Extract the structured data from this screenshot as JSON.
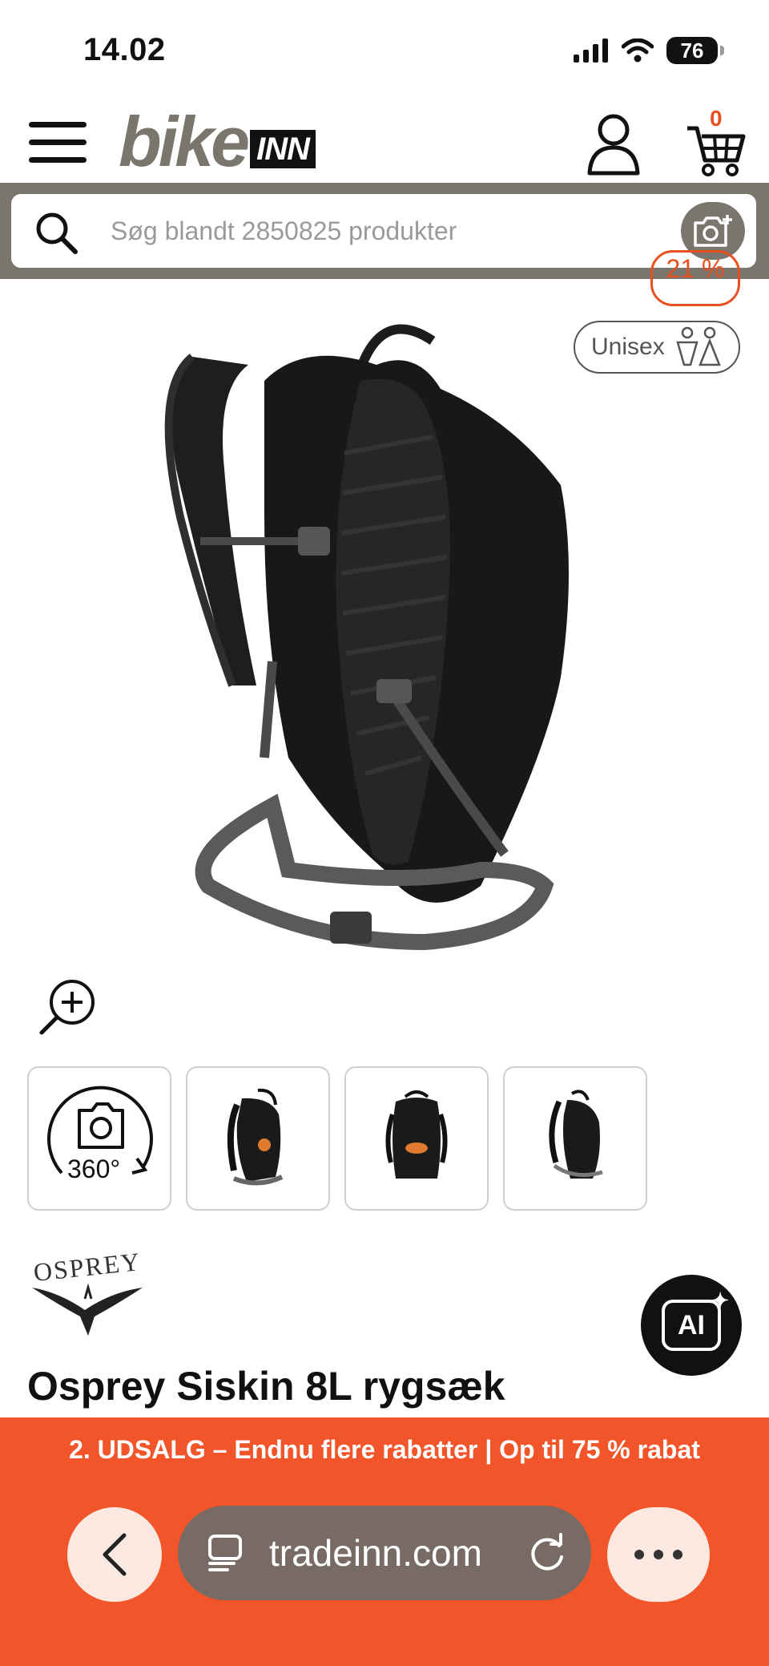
{
  "status_bar": {
    "time": "14.02",
    "battery": "76",
    "icons": [
      "cellular-signal-icon",
      "wifi-icon",
      "battery-icon"
    ]
  },
  "header": {
    "logo_part1": "bike",
    "logo_part2": "INN",
    "cart_count": "0",
    "icons": [
      "hamburger-menu-icon",
      "user-icon",
      "shopping-cart-icon"
    ]
  },
  "search": {
    "placeholder": "Søg blandt 2850825 produkter",
    "icons": [
      "search-icon",
      "camera-search-icon"
    ]
  },
  "product_gallery": {
    "discount_badge": "21 %",
    "gender_badge": "Unisex",
    "thumbnails": [
      "360°",
      "thumbnail-2",
      "thumbnail-3",
      "thumbnail-4"
    ],
    "icons": [
      "zoom-in-icon",
      "rotate-360-icon",
      "unisex-icon"
    ]
  },
  "product": {
    "brand": "OSPREY",
    "title": "Osprey Siskin 8L rygsæk"
  },
  "ai_button": {
    "label": "AI"
  },
  "promo": {
    "text": "2. UDSALG – Endnu flere rabatter | Op til 75 % rabat"
  },
  "browser": {
    "url": "tradeinn.com",
    "icons": [
      "back-chevron-icon",
      "tabs-icon",
      "reload-icon",
      "more-dots-icon"
    ]
  },
  "colors": {
    "brand_grey": "#7a766e",
    "accent_orange": "#e8501f",
    "promo_orange": "#f2552a",
    "address_bar": "#786b66"
  }
}
